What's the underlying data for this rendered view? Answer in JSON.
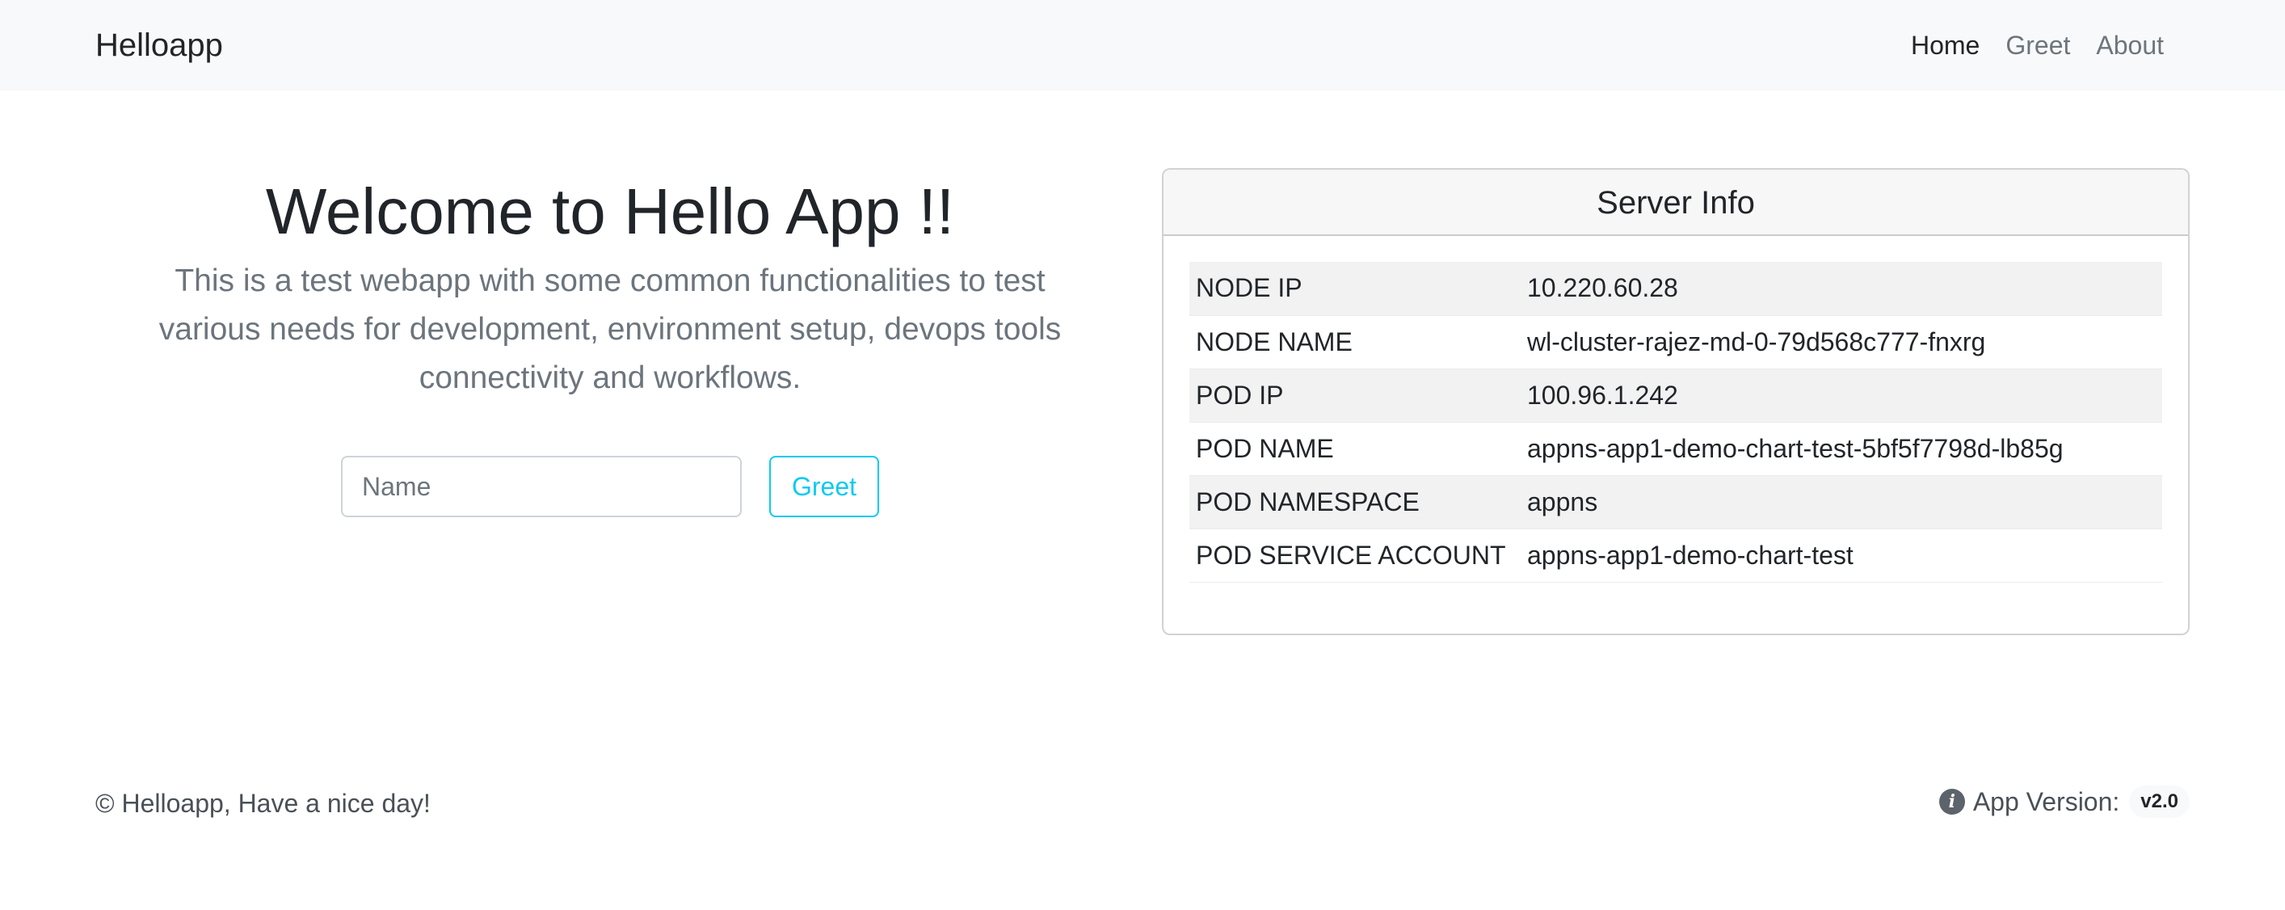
{
  "navbar": {
    "brand": "Helloapp",
    "links": [
      {
        "label": "Home",
        "active": true
      },
      {
        "label": "Greet",
        "active": false
      },
      {
        "label": "About",
        "active": false
      }
    ]
  },
  "hero": {
    "title": "Welcome to Hello App !!",
    "lead": "This is a test webapp with some common functionalities to test various needs for development, environment setup, devops tools connectivity and workflows."
  },
  "greet_form": {
    "name_placeholder": "Name",
    "name_value": "",
    "button_label": "Greet"
  },
  "server_info": {
    "title": "Server Info",
    "rows": [
      {
        "key": "NODE IP",
        "value": "10.220.60.28"
      },
      {
        "key": "NODE NAME",
        "value": "wl-cluster-rajez-md-0-79d568c777-fnxrg"
      },
      {
        "key": "POD IP",
        "value": "100.96.1.242"
      },
      {
        "key": "POD NAME",
        "value": "appns-app1-demo-chart-test-5bf5f7798d-lb85g"
      },
      {
        "key": "POD NAMESPACE",
        "value": "appns"
      },
      {
        "key": "POD SERVICE ACCOUNT",
        "value": "appns-app1-demo-chart-test"
      }
    ]
  },
  "footer": {
    "copyright": "© Helloapp, Have a nice day!",
    "version_icon": "info-icon",
    "version_label": "App Version:",
    "version_value": "v2.0"
  },
  "colors": {
    "navbar_bg": "#f8f9fa",
    "accent_info": "#0dcaf0",
    "muted_text": "#6c757d"
  }
}
